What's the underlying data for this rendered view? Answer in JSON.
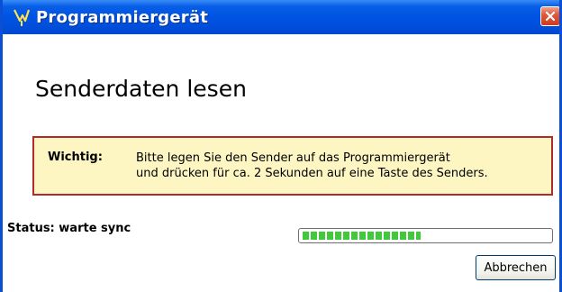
{
  "window": {
    "title": "Programmiergerät",
    "title_icon": "app-icon",
    "close_icon": "close-icon",
    "accent_color": "#0054e3"
  },
  "main": {
    "heading": "Senderdaten lesen"
  },
  "notice": {
    "label": "Wichtig:",
    "line1": "Bitte legen Sie den Sender auf das Programmiergerät",
    "line2": "und drücken für ca. 2 Sekunden auf eine Taste des Senders.",
    "background_color": "#fdf6c3",
    "border_color": "#b12b2b"
  },
  "status": {
    "text": "Status: warte sync"
  },
  "progress": {
    "fraction": 0.48,
    "color": "#3fc93b"
  },
  "buttons": {
    "cancel_label": "Abbrechen"
  }
}
